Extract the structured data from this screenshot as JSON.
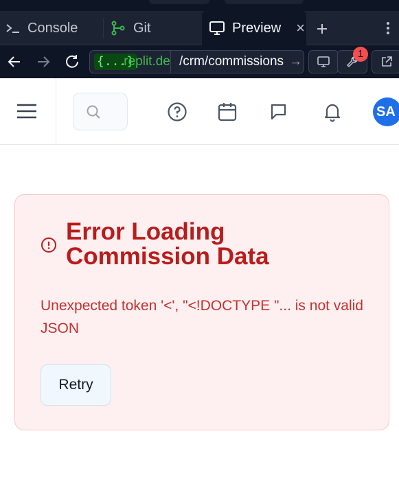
{
  "ide": {
    "tabs": [
      {
        "label": "Console",
        "icon": "terminal-icon"
      },
      {
        "label": "Git",
        "icon": "git-branch-icon"
      },
      {
        "label": "Preview",
        "icon": "monitor-icon",
        "active": true
      }
    ],
    "url": {
      "badge": "{...}",
      "host": ".replit.de",
      "path": "/crm/commissions",
      "path_arrow": "→"
    },
    "notification_count": "1"
  },
  "app_header": {
    "avatar_initials": "SA"
  },
  "error": {
    "title": "Error Loading Commission Data",
    "message": "Unexpected token '<', \"<!DOCTYPE \"... is not valid JSON",
    "retry_label": "Retry"
  },
  "colors": {
    "ide_dark": "#0e1525",
    "ide_panel": "#1c2333",
    "error_text": "#b91c1c",
    "error_bg": "#fef0f0",
    "avatar_bg": "#1f6fe8"
  }
}
